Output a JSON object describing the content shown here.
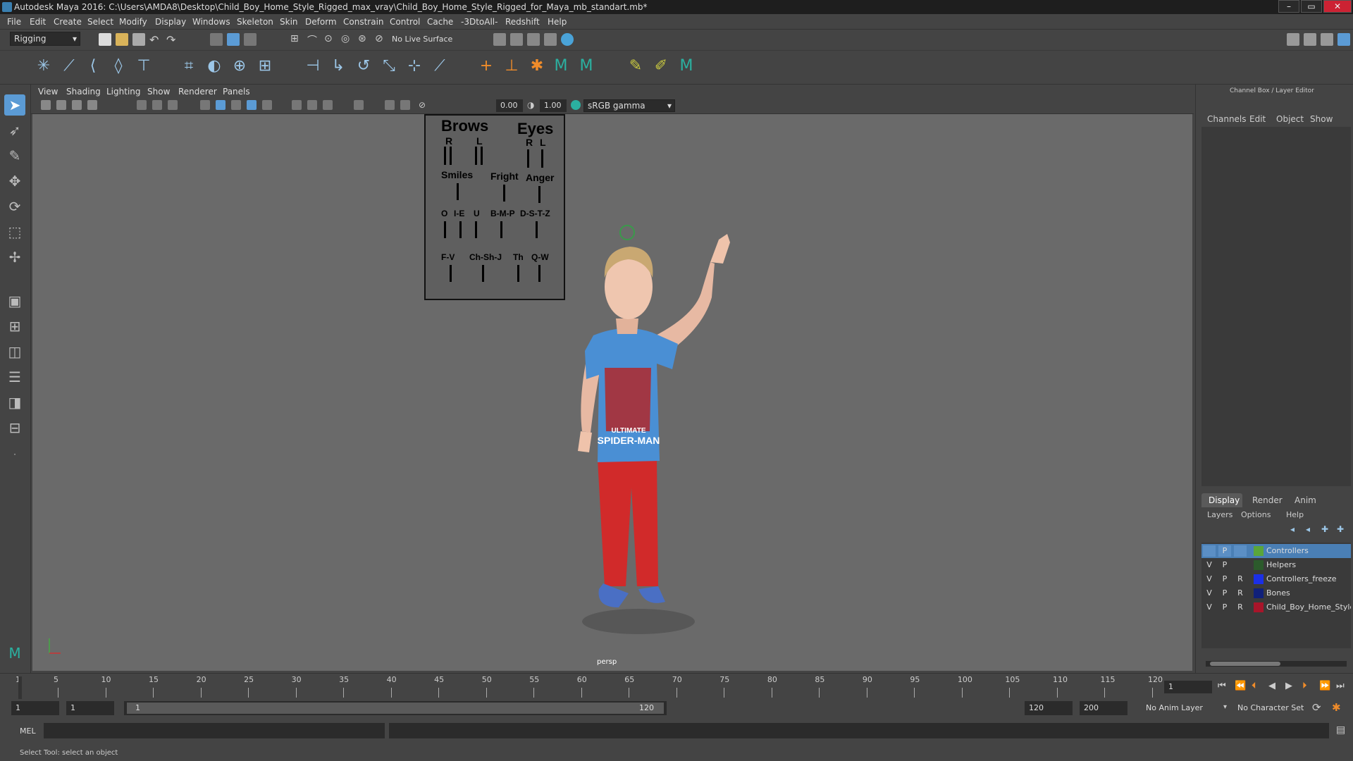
{
  "title": "Autodesk Maya 2016: C:\\Users\\AMDA8\\Desktop\\Child_Boy_Home_Style_Rigged_max_vray\\Child_Boy_Home_Style_Rigged_for_Maya_mb_standart.mb*",
  "window_buttons": [
    "–",
    "▭",
    "✕"
  ],
  "menu": [
    "File",
    "Edit",
    "Create",
    "Select",
    "Modify",
    "Display",
    "Windows",
    "Skeleton",
    "Skin",
    "Deform",
    "Constrain",
    "Control",
    "Cache",
    "-3DtoAll-",
    "Redshift",
    "Help"
  ],
  "status_line": {
    "menuset": "Rigging",
    "live_surface": "No Live Surface"
  },
  "panel_menu": [
    "View",
    "Shading",
    "Lighting",
    "Show",
    "Renderer",
    "Panels"
  ],
  "panel_toolbar": {
    "exposure": "0.00",
    "gamma": "1.00",
    "color_space": "sRGB gamma"
  },
  "faceboard": {
    "brows": "Brows",
    "eyes": "Eyes",
    "brows_r": "R",
    "brows_l": "L",
    "eyes_r": "R",
    "eyes_l": "L",
    "smiles": "Smiles",
    "fright": "Fright",
    "anger": "Anger",
    "phon_o": "O",
    "phon_ie": "I-E",
    "phon_u": "U",
    "phon_bmp": "B-M-P",
    "phon_dstz": "D-S-T-Z",
    "phon_fv": "F-V",
    "phon_chshj": "Ch-Sh-J",
    "phon_th": "Th",
    "phon_qw": "Q-W"
  },
  "viewport": {
    "camera_label": "persp",
    "shirt_text_1": "ULTIMATE",
    "shirt_text_2": "SPIDER-MAN"
  },
  "right_panel": {
    "title": "Channel Box / Layer Editor",
    "cb_tabs": [
      "Channels",
      "Edit",
      "Object",
      "Show"
    ],
    "layer_tabs": [
      "Display",
      "Render",
      "Anim"
    ],
    "layer_menu": [
      "Layers",
      "Options",
      "Help"
    ],
    "layers": [
      {
        "v": "",
        "p": "P",
        "r": "",
        "name": "Controllers",
        "color": "#5aa53a"
      },
      {
        "v": "V",
        "p": "P",
        "r": "",
        "name": "Helpers",
        "color": "#2c5a2c"
      },
      {
        "v": "V",
        "p": "P",
        "r": "R",
        "name": "Controllers_freeze",
        "color": "#1b2fe6"
      },
      {
        "v": "V",
        "p": "P",
        "r": "R",
        "name": "Bones",
        "color": "#10207a"
      },
      {
        "v": "V",
        "p": "P",
        "r": "R",
        "name": "Child_Boy_Home_Style",
        "color": "#a8152a"
      }
    ]
  },
  "timeline": {
    "ticks": [
      "1",
      "5",
      "10",
      "15",
      "20",
      "25",
      "30",
      "35",
      "40",
      "45",
      "50",
      "55",
      "60",
      "65",
      "70",
      "75",
      "80",
      "85",
      "90",
      "95",
      "100",
      "105",
      "110",
      "115",
      "120"
    ],
    "current_frame": "1"
  },
  "range": {
    "start": "1",
    "playback_start": "1",
    "slider_start": "1",
    "slider_end": "120",
    "playback_end": "120",
    "end": "200",
    "anim_layer": "No Anim Layer",
    "character_set": "No Character Set"
  },
  "command_line": {
    "language": "MEL"
  },
  "help_line": "Select Tool: select an object",
  "colors": {
    "accent": "#5b9bd5",
    "selected_layer": "#4a7fb5",
    "viewport_bg": "#6a6a6a"
  }
}
